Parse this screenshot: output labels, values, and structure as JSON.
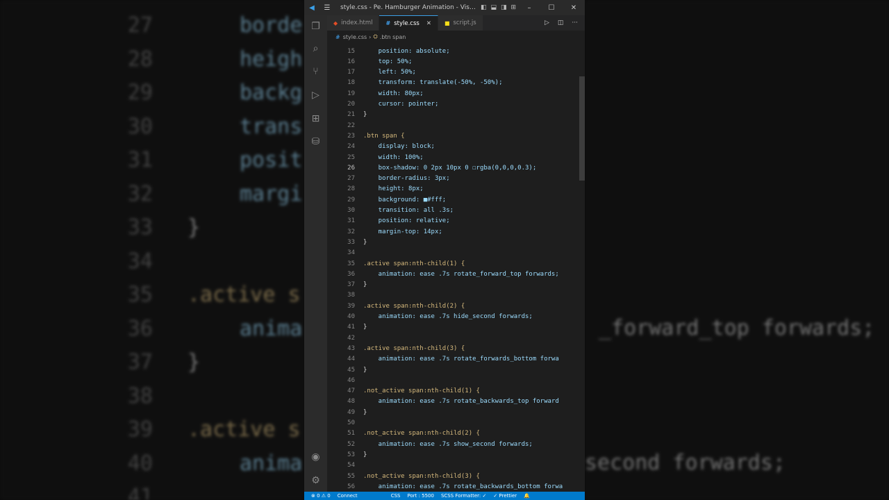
{
  "window": {
    "title": "style.css - Pe. Hamburger Animation - Visual Studio ...",
    "minimize": "–",
    "maximize": "☐",
    "close": "✕"
  },
  "tabs": [
    {
      "label": "index.html",
      "icon": "html-file-icon",
      "active": false
    },
    {
      "label": "style.css",
      "icon": "css-file-icon",
      "active": true
    },
    {
      "label": "script.js",
      "icon": "js-file-icon",
      "active": false
    }
  ],
  "breadcrumb": {
    "file": "style.css",
    "symbol": ".btn span"
  },
  "editor": {
    "current_line": 26,
    "lines": [
      {
        "n": 15,
        "text": "    position: absolute;"
      },
      {
        "n": 16,
        "text": "    top: 50%;"
      },
      {
        "n": 17,
        "text": "    left: 50%;"
      },
      {
        "n": 18,
        "text": "    transform: translate(-50%, -50%);"
      },
      {
        "n": 19,
        "text": "    width: 80px;"
      },
      {
        "n": 20,
        "text": "    cursor: pointer;"
      },
      {
        "n": 21,
        "text": "}"
      },
      {
        "n": 22,
        "text": ""
      },
      {
        "n": 23,
        "text": ".btn span {"
      },
      {
        "n": 24,
        "text": "    display: block;"
      },
      {
        "n": 25,
        "text": "    width: 100%;"
      },
      {
        "n": 26,
        "text": "    box-shadow: 0 2px 10px 0 ☐rgba(0,0,0,0.3);"
      },
      {
        "n": 27,
        "text": "    border-radius: 3px;"
      },
      {
        "n": 28,
        "text": "    height: 8px;"
      },
      {
        "n": 29,
        "text": "    background: ■#fff;"
      },
      {
        "n": 30,
        "text": "    transition: all .3s;"
      },
      {
        "n": 31,
        "text": "    position: relative;"
      },
      {
        "n": 32,
        "text": "    margin-top: 14px;"
      },
      {
        "n": 33,
        "text": "}"
      },
      {
        "n": 34,
        "text": ""
      },
      {
        "n": 35,
        "text": ".active span:nth-child(1) {"
      },
      {
        "n": 36,
        "text": "    animation: ease .7s rotate_forward_top forwards;"
      },
      {
        "n": 37,
        "text": "}"
      },
      {
        "n": 38,
        "text": ""
      },
      {
        "n": 39,
        "text": ".active span:nth-child(2) {"
      },
      {
        "n": 40,
        "text": "    animation: ease .7s hide_second forwards;"
      },
      {
        "n": 41,
        "text": "}"
      },
      {
        "n": 42,
        "text": ""
      },
      {
        "n": 43,
        "text": ".active span:nth-child(3) {"
      },
      {
        "n": 44,
        "text": "    animation: ease .7s rotate_forwards_bottom forwa"
      },
      {
        "n": 45,
        "text": "}"
      },
      {
        "n": 46,
        "text": ""
      },
      {
        "n": 47,
        "text": ".not_active span:nth-child(1) {"
      },
      {
        "n": 48,
        "text": "    animation: ease .7s rotate_backwards_top forward"
      },
      {
        "n": 49,
        "text": "}"
      },
      {
        "n": 50,
        "text": ""
      },
      {
        "n": 51,
        "text": ".not_active span:nth-child(2) {"
      },
      {
        "n": 52,
        "text": "    animation: ease .7s show_second forwards;"
      },
      {
        "n": 53,
        "text": "}"
      },
      {
        "n": 54,
        "text": ""
      },
      {
        "n": 55,
        "text": ".not_active span:nth-child(3) {"
      },
      {
        "n": 56,
        "text": "    animation: ease .7s rotate_backwards_bottom forwa"
      }
    ]
  },
  "statusbar": {
    "problems": "⊗ 0 ⚠ 0",
    "connect": "Connect",
    "language": "CSS",
    "port": "Port : 5500",
    "scss_formatter": "SCSS Formatter: ✓",
    "prettier": "✓ Prettier"
  },
  "background_left": [
    {
      "n": "27",
      "text": "borde"
    },
    {
      "n": "28",
      "text": "heigh"
    },
    {
      "n": "29",
      "text": "backg"
    },
    {
      "n": "30",
      "text": "trans"
    },
    {
      "n": "31",
      "text": "posit"
    },
    {
      "n": "32",
      "text": "margi"
    },
    {
      "n": "33",
      "text": "}"
    },
    {
      "n": "34",
      "text": ""
    },
    {
      "n": "35",
      "text": ".active s"
    },
    {
      "n": "36",
      "text": "anima"
    },
    {
      "n": "37",
      "text": "}"
    },
    {
      "n": "38",
      "text": ""
    },
    {
      "n": "39",
      "text": ".active s"
    },
    {
      "n": "40",
      "text": "anima"
    },
    {
      "n": "41",
      "text": ""
    }
  ],
  "background_right": [
    {
      "text": "_forward_top forwards;"
    },
    {
      "text": "second forwards;"
    }
  ],
  "colors": {
    "keyword": "#d7ba7d",
    "property": "#9cdcfe",
    "value": "#ce9178",
    "number": "#b5cea8",
    "accent": "#007acc"
  }
}
